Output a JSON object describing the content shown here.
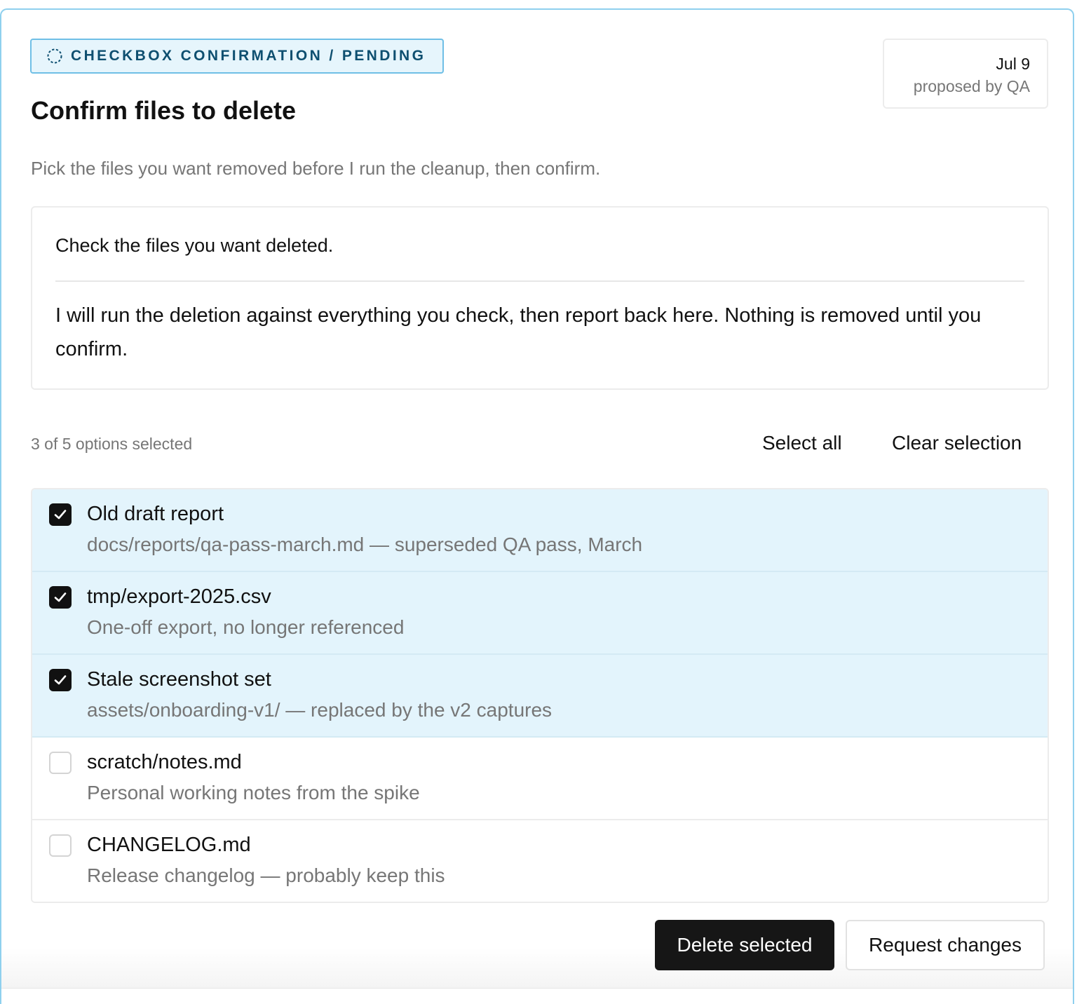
{
  "header": {
    "status_label": "CHECKBOX CONFIRMATION / PENDING",
    "status_icon": "pending-dashed-circle-icon",
    "title": "Confirm files to delete",
    "subtitle": "Pick the files you want removed before I run the cleanup, then confirm."
  },
  "meta": {
    "date": "Jul 9",
    "proposed_by": "proposed by QA"
  },
  "message": {
    "prompt": "Check the files you want deleted.",
    "body": "I will run the deletion against everything you check, then report back here. Nothing is removed until you confirm."
  },
  "selection": {
    "count_text": "3 of 5 options selected",
    "selected": 3,
    "total": 5,
    "select_all_label": "Select all",
    "clear_label": "Clear selection"
  },
  "options": [
    {
      "title": "Old draft report",
      "description": "docs/reports/qa-pass-march.md — superseded QA pass, March",
      "checked": true
    },
    {
      "title": "tmp/export-2025.csv",
      "description": "One-off export, no longer referenced",
      "checked": true
    },
    {
      "title": "Stale screenshot set",
      "description": "assets/onboarding-v1/ — replaced by the v2 captures",
      "checked": true
    },
    {
      "title": "scratch/notes.md",
      "description": "Personal working notes from the spike",
      "checked": false
    },
    {
      "title": "CHANGELOG.md",
      "description": "Release changelog — probably keep this",
      "checked": false
    }
  ],
  "actions": {
    "primary_label": "Delete selected",
    "secondary_label": "Request changes"
  },
  "colors": {
    "accent_border": "#6fbfe6",
    "accent_bg": "#e6f5fc",
    "status_text": "#0e4f70",
    "checked_row_bg": "#e3f4fc",
    "primary_button": "#161616"
  }
}
